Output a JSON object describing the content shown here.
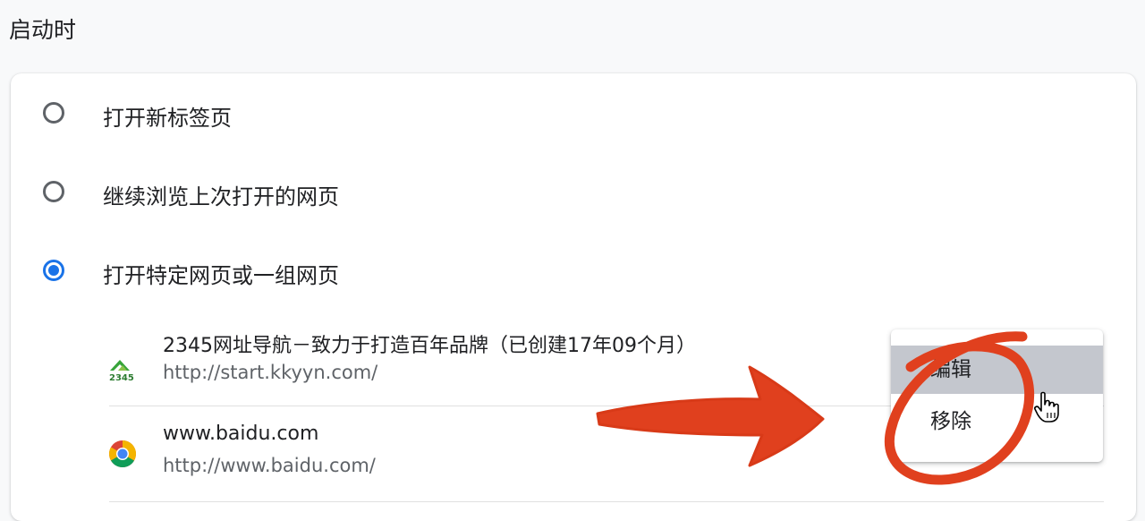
{
  "section": {
    "title": "启动时"
  },
  "startup_options": [
    {
      "label": "打开新标签页",
      "checked": false
    },
    {
      "label": "继续浏览上次打开的网页",
      "checked": false
    },
    {
      "label": "打开特定网页或一组网页",
      "checked": true
    }
  ],
  "pages": [
    {
      "title": "2345网址导航－致力于打造百年品牌（已创建17年09个月）",
      "url": "http://start.kkyyn.com/",
      "icon": "2345-logo-icon"
    },
    {
      "title": "www.baidu.com",
      "url": "http://www.baidu.com/",
      "icon": "chrome-icon"
    }
  ],
  "context_menu": {
    "edit_label": "编辑",
    "remove_label": "移除",
    "hovered": "编辑"
  },
  "favicon_2345": {
    "text": "2345"
  },
  "colors": {
    "accent": "#1a73e8",
    "annotation": "#e0401e",
    "menu_hover": "#c4c7ce"
  }
}
